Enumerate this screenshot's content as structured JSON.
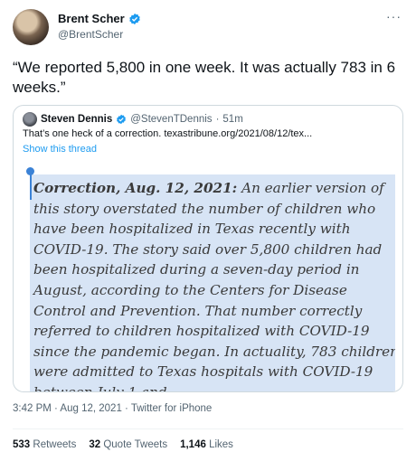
{
  "author": {
    "name": "Brent Scher",
    "handle": "@BrentScher",
    "more_label": "···"
  },
  "tweet": {
    "text": "“We reported 5,800 in one week. It was actually 783 in 6 weeks.”"
  },
  "quote": {
    "name": "Steven Dennis",
    "handle": "@StevenTDennis",
    "separator": "·",
    "time": "51m",
    "text": "That’s one heck of a correction.  texastribune.org/2021/08/12/tex...",
    "show_thread": "Show this thread",
    "image": {
      "correction_lead": "Correction, Aug. 12, 2021:",
      "correction_body": " An earlier version of this story overstated the number of children who have been hospitalized in Texas recently with COVID-19. The story said over 5,800 children had been hospitalized during a seven-day period in August, according to the Centers for Disease Control and Prevention. That number correctly referred to children hospitalized with COVID-19 since the pandemic began. In actuality, 783 children were admitted to Texas hospitals with COVID-19 between July 1 and"
    }
  },
  "meta": {
    "text": "3:42 PM · Aug 12, 2021 · Twitter for iPhone"
  },
  "stats": {
    "retweets_count": "533",
    "retweets_label": "Retweets",
    "quote_count": "32",
    "quote_label": "Quote Tweets",
    "likes_count": "1,146",
    "likes_label": "Likes"
  },
  "colors": {
    "verified": "#1d9bf0",
    "link": "#1d9bf0",
    "highlight": "#d7e4f5"
  }
}
